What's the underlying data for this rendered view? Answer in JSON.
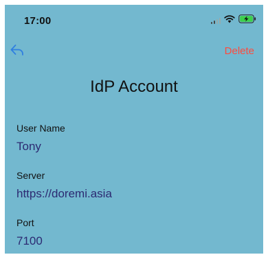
{
  "status_bar": {
    "time": "17:00",
    "icons": [
      "signal-icon",
      "wifi-icon",
      "battery-charging-icon"
    ]
  },
  "nav": {
    "back_icon": "back-arrow-icon",
    "delete_label": "Delete"
  },
  "page": {
    "title": "IdP Account"
  },
  "fields": {
    "user_name": {
      "label": "User Name",
      "value": "Tony"
    },
    "server": {
      "label": "Server",
      "value": "https://doremi.asia"
    },
    "port": {
      "label": "Port",
      "value": "7100"
    }
  },
  "colors": {
    "background": "#73b8cf",
    "accent_blue": "#2f7fe0",
    "delete_red": "#ff4a3d",
    "value_text": "#2c2a72",
    "battery_green": "#3cd04a"
  }
}
